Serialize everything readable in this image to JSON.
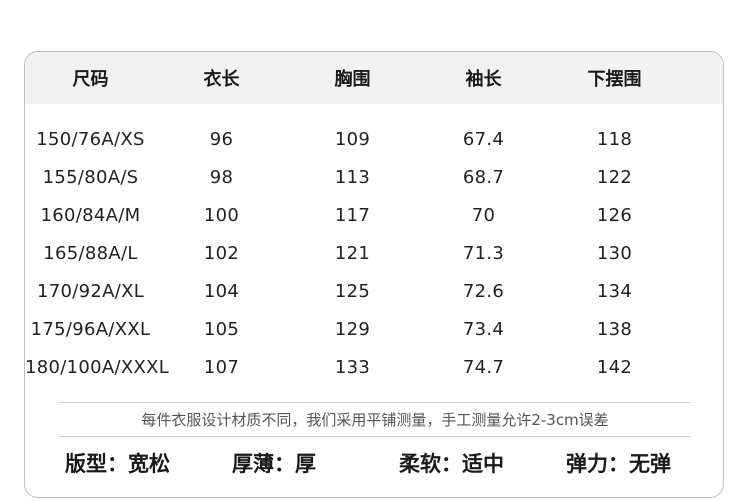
{
  "table": {
    "headers": [
      "尺码",
      "衣长",
      "胸围",
      "袖长",
      "下摆围"
    ],
    "rows": [
      [
        "150/76A/XS",
        "96",
        "109",
        "67.4",
        "118"
      ],
      [
        "155/80A/S",
        "98",
        "113",
        "68.7",
        "122"
      ],
      [
        "160/84A/M",
        "100",
        "117",
        "70",
        "126"
      ],
      [
        "165/88A/L",
        "102",
        "121",
        "71.3",
        "130"
      ],
      [
        "170/92A/XL",
        "104",
        "125",
        "72.6",
        "134"
      ],
      [
        "175/96A/XXL",
        "105",
        "129",
        "73.4",
        "138"
      ],
      [
        "180/100A/XXXL",
        "107",
        "133",
        "74.7",
        "142"
      ]
    ]
  },
  "note": "每件衣服设计材质不同，我们采用平铺测量，手工测量允许2-3cm误差",
  "properties": [
    {
      "label": "版型：",
      "value": "宽松"
    },
    {
      "label": "厚薄：",
      "value": "厚"
    },
    {
      "label": "柔软：",
      "value": "适中"
    },
    {
      "label": "弹力：",
      "value": "无弹"
    }
  ]
}
